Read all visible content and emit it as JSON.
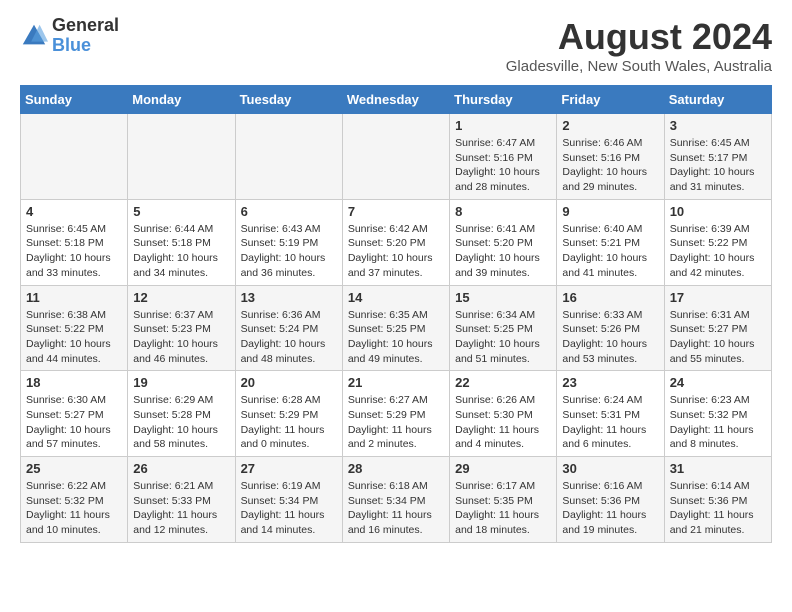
{
  "logo": {
    "general": "General",
    "blue": "Blue"
  },
  "header": {
    "title": "August 2024",
    "subtitle": "Gladesville, New South Wales, Australia"
  },
  "weekdays": [
    "Sunday",
    "Monday",
    "Tuesday",
    "Wednesday",
    "Thursday",
    "Friday",
    "Saturday"
  ],
  "weeks": [
    [
      {
        "day": "",
        "info": ""
      },
      {
        "day": "",
        "info": ""
      },
      {
        "day": "",
        "info": ""
      },
      {
        "day": "",
        "info": ""
      },
      {
        "day": "1",
        "info": "Sunrise: 6:47 AM\nSunset: 5:16 PM\nDaylight: 10 hours\nand 28 minutes."
      },
      {
        "day": "2",
        "info": "Sunrise: 6:46 AM\nSunset: 5:16 PM\nDaylight: 10 hours\nand 29 minutes."
      },
      {
        "day": "3",
        "info": "Sunrise: 6:45 AM\nSunset: 5:17 PM\nDaylight: 10 hours\nand 31 minutes."
      }
    ],
    [
      {
        "day": "4",
        "info": "Sunrise: 6:45 AM\nSunset: 5:18 PM\nDaylight: 10 hours\nand 33 minutes."
      },
      {
        "day": "5",
        "info": "Sunrise: 6:44 AM\nSunset: 5:18 PM\nDaylight: 10 hours\nand 34 minutes."
      },
      {
        "day": "6",
        "info": "Sunrise: 6:43 AM\nSunset: 5:19 PM\nDaylight: 10 hours\nand 36 minutes."
      },
      {
        "day": "7",
        "info": "Sunrise: 6:42 AM\nSunset: 5:20 PM\nDaylight: 10 hours\nand 37 minutes."
      },
      {
        "day": "8",
        "info": "Sunrise: 6:41 AM\nSunset: 5:20 PM\nDaylight: 10 hours\nand 39 minutes."
      },
      {
        "day": "9",
        "info": "Sunrise: 6:40 AM\nSunset: 5:21 PM\nDaylight: 10 hours\nand 41 minutes."
      },
      {
        "day": "10",
        "info": "Sunrise: 6:39 AM\nSunset: 5:22 PM\nDaylight: 10 hours\nand 42 minutes."
      }
    ],
    [
      {
        "day": "11",
        "info": "Sunrise: 6:38 AM\nSunset: 5:22 PM\nDaylight: 10 hours\nand 44 minutes."
      },
      {
        "day": "12",
        "info": "Sunrise: 6:37 AM\nSunset: 5:23 PM\nDaylight: 10 hours\nand 46 minutes."
      },
      {
        "day": "13",
        "info": "Sunrise: 6:36 AM\nSunset: 5:24 PM\nDaylight: 10 hours\nand 48 minutes."
      },
      {
        "day": "14",
        "info": "Sunrise: 6:35 AM\nSunset: 5:25 PM\nDaylight: 10 hours\nand 49 minutes."
      },
      {
        "day": "15",
        "info": "Sunrise: 6:34 AM\nSunset: 5:25 PM\nDaylight: 10 hours\nand 51 minutes."
      },
      {
        "day": "16",
        "info": "Sunrise: 6:33 AM\nSunset: 5:26 PM\nDaylight: 10 hours\nand 53 minutes."
      },
      {
        "day": "17",
        "info": "Sunrise: 6:31 AM\nSunset: 5:27 PM\nDaylight: 10 hours\nand 55 minutes."
      }
    ],
    [
      {
        "day": "18",
        "info": "Sunrise: 6:30 AM\nSunset: 5:27 PM\nDaylight: 10 hours\nand 57 minutes."
      },
      {
        "day": "19",
        "info": "Sunrise: 6:29 AM\nSunset: 5:28 PM\nDaylight: 10 hours\nand 58 minutes."
      },
      {
        "day": "20",
        "info": "Sunrise: 6:28 AM\nSunset: 5:29 PM\nDaylight: 11 hours\nand 0 minutes."
      },
      {
        "day": "21",
        "info": "Sunrise: 6:27 AM\nSunset: 5:29 PM\nDaylight: 11 hours\nand 2 minutes."
      },
      {
        "day": "22",
        "info": "Sunrise: 6:26 AM\nSunset: 5:30 PM\nDaylight: 11 hours\nand 4 minutes."
      },
      {
        "day": "23",
        "info": "Sunrise: 6:24 AM\nSunset: 5:31 PM\nDaylight: 11 hours\nand 6 minutes."
      },
      {
        "day": "24",
        "info": "Sunrise: 6:23 AM\nSunset: 5:32 PM\nDaylight: 11 hours\nand 8 minutes."
      }
    ],
    [
      {
        "day": "25",
        "info": "Sunrise: 6:22 AM\nSunset: 5:32 PM\nDaylight: 11 hours\nand 10 minutes."
      },
      {
        "day": "26",
        "info": "Sunrise: 6:21 AM\nSunset: 5:33 PM\nDaylight: 11 hours\nand 12 minutes."
      },
      {
        "day": "27",
        "info": "Sunrise: 6:19 AM\nSunset: 5:34 PM\nDaylight: 11 hours\nand 14 minutes."
      },
      {
        "day": "28",
        "info": "Sunrise: 6:18 AM\nSunset: 5:34 PM\nDaylight: 11 hours\nand 16 minutes."
      },
      {
        "day": "29",
        "info": "Sunrise: 6:17 AM\nSunset: 5:35 PM\nDaylight: 11 hours\nand 18 minutes."
      },
      {
        "day": "30",
        "info": "Sunrise: 6:16 AM\nSunset: 5:36 PM\nDaylight: 11 hours\nand 19 minutes."
      },
      {
        "day": "31",
        "info": "Sunrise: 6:14 AM\nSunset: 5:36 PM\nDaylight: 11 hours\nand 21 minutes."
      }
    ]
  ]
}
